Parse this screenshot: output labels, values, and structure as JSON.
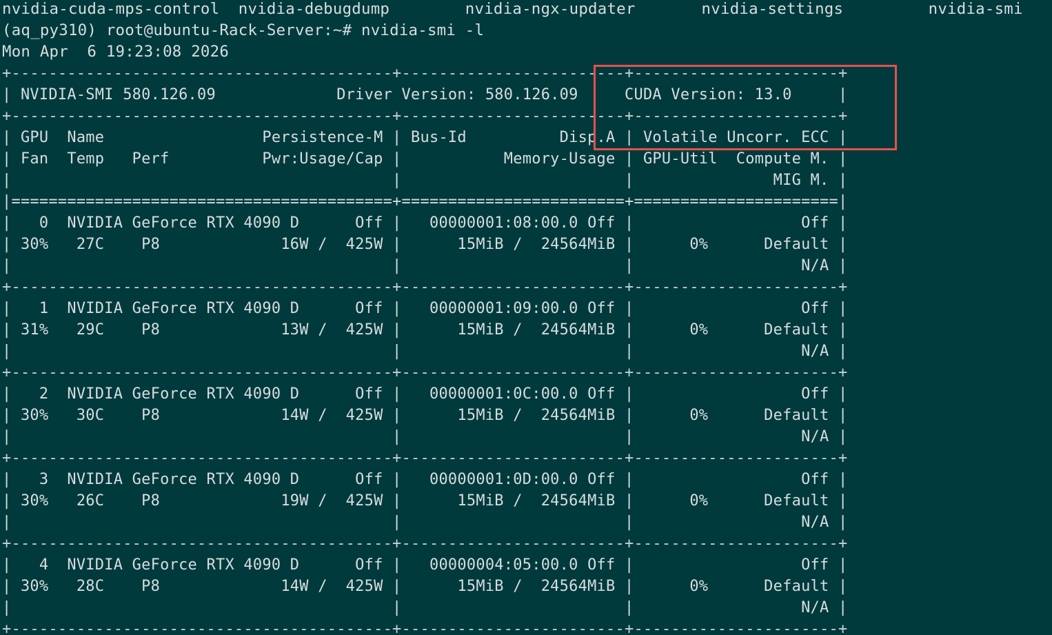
{
  "terminal": {
    "ls_output_line": "nvidia-cuda-mps-control  nvidia-debugdump        nvidia-ngx-updater       nvidia-settings         nvidia-smi",
    "prompt": "(aq_py310) root@ubuntu-Rack-Server:~# nvidia-smi -l",
    "date_line": "Mon Apr  6 19:23:08 2026",
    "colors": {
      "background": "#013a3c",
      "foreground": "#d6dde0",
      "highlight_box": "#e8504d"
    }
  },
  "smi": {
    "separator_line": "+-----------------------------------------+------------------------+----------------------+",
    "header_line": "| NVIDIA-SMI 580.126.09             Driver Version: 580.126.09     CUDA Version: 13.0     |",
    "header_sep": "+-----------------------------------------+------------------------+----------------------+",
    "col_head_1": "| GPU  Name                 Persistence-M | Bus-Id          Disp.A | Volatile Uncorr. ECC |",
    "col_head_2": "| Fan  Temp   Perf          Pwr:Usage/Cap |           Memory-Usage | GPU-Util  Compute M. |",
    "col_head_3": "|                                         |                        |               MIG M. |",
    "double_sep": "|=========================================+========================+======================|",
    "gpus": [
      {
        "line1": "|   0  NVIDIA GeForce RTX 4090 D      Off |   00000001:08:00.0 Off |                  Off |",
        "line2": "| 30%   27C    P8             16W /  425W |      15MiB /  24564MiB |      0%      Default |",
        "line3": "|                                         |                        |                  N/A |",
        "sep": "+-----------------------------------------+------------------------+----------------------+"
      },
      {
        "line1": "|   1  NVIDIA GeForce RTX 4090 D      Off |   00000001:09:00.0 Off |                  Off |",
        "line2": "| 31%   29C    P8             13W /  425W |      15MiB /  24564MiB |      0%      Default |",
        "line3": "|                                         |                        |                  N/A |",
        "sep": "+-----------------------------------------+------------------------+----------------------+"
      },
      {
        "line1": "|   2  NVIDIA GeForce RTX 4090 D      Off |   00000001:0C:00.0 Off |                  Off |",
        "line2": "| 30%   30C    P8             14W /  425W |      15MiB /  24564MiB |      0%      Default |",
        "line3": "|                                         |                        |                  N/A |",
        "sep": "+-----------------------------------------+------------------------+----------------------+"
      },
      {
        "line1": "|   3  NVIDIA GeForce RTX 4090 D      Off |   00000001:0D:00.0 Off |                  Off |",
        "line2": "| 30%   26C    P8             19W /  425W |      15MiB /  24564MiB |      0%      Default |",
        "line3": "|                                         |                        |                  N/A |",
        "sep": "+-----------------------------------------+------------------------+----------------------+"
      },
      {
        "line1": "|   4  NVIDIA GeForce RTX 4090 D      Off |   00000004:05:00.0 Off |                  Off |",
        "line2": "| 30%   28C    P8             14W /  425W |      15MiB /  24564MiB |      0%      Default |",
        "line3": "|                                         |                        |                  N/A |",
        "sep": "+-----------------------------------------+------------------------+----------------------+"
      }
    ]
  }
}
